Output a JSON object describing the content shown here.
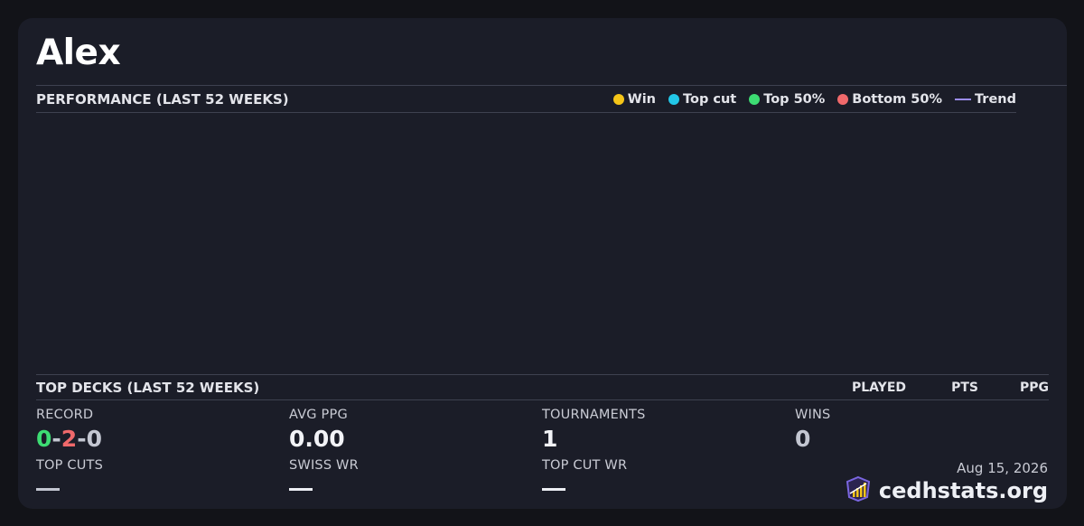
{
  "player": {
    "name": "Alex"
  },
  "performance": {
    "heading": "PERFORMANCE (LAST 52 WEEKS)",
    "legend": [
      {
        "label": "Win",
        "color": "#f5c518",
        "shape": "dot"
      },
      {
        "label": "Top cut",
        "color": "#22c7e8",
        "shape": "dot"
      },
      {
        "label": "Top 50%",
        "color": "#3ddc73",
        "shape": "dot"
      },
      {
        "label": "Bottom 50%",
        "color": "#f0696b",
        "shape": "dot"
      },
      {
        "label": "Trend",
        "color": "#9b8cf0",
        "shape": "line"
      }
    ]
  },
  "top_decks": {
    "heading": "TOP DECKS (LAST 52 WEEKS)",
    "columns": [
      "PLAYED",
      "PTS",
      "PPG"
    ]
  },
  "stats": {
    "record": {
      "label": "RECORD",
      "wins": "0",
      "losses": "2",
      "draws": "0",
      "sep": "-"
    },
    "avg_ppg": {
      "label": "AVG PPG",
      "value": "0.00"
    },
    "tournaments": {
      "label": "TOURNAMENTS",
      "value": "1"
    },
    "wins": {
      "label": "WINS",
      "value": "0"
    },
    "top_cuts": {
      "label": "TOP CUTS",
      "value": "—"
    },
    "swiss_wr": {
      "label": "SWISS WR",
      "value": "—"
    },
    "top_cut_wr": {
      "label": "TOP CUT WR",
      "value": "—"
    }
  },
  "footer": {
    "date": "Aug 15, 2026",
    "brand": "cedhstats.org"
  },
  "colors": {
    "win": "#3ddc73",
    "loss": "#f0696b",
    "draw": "#c3c6d1"
  }
}
